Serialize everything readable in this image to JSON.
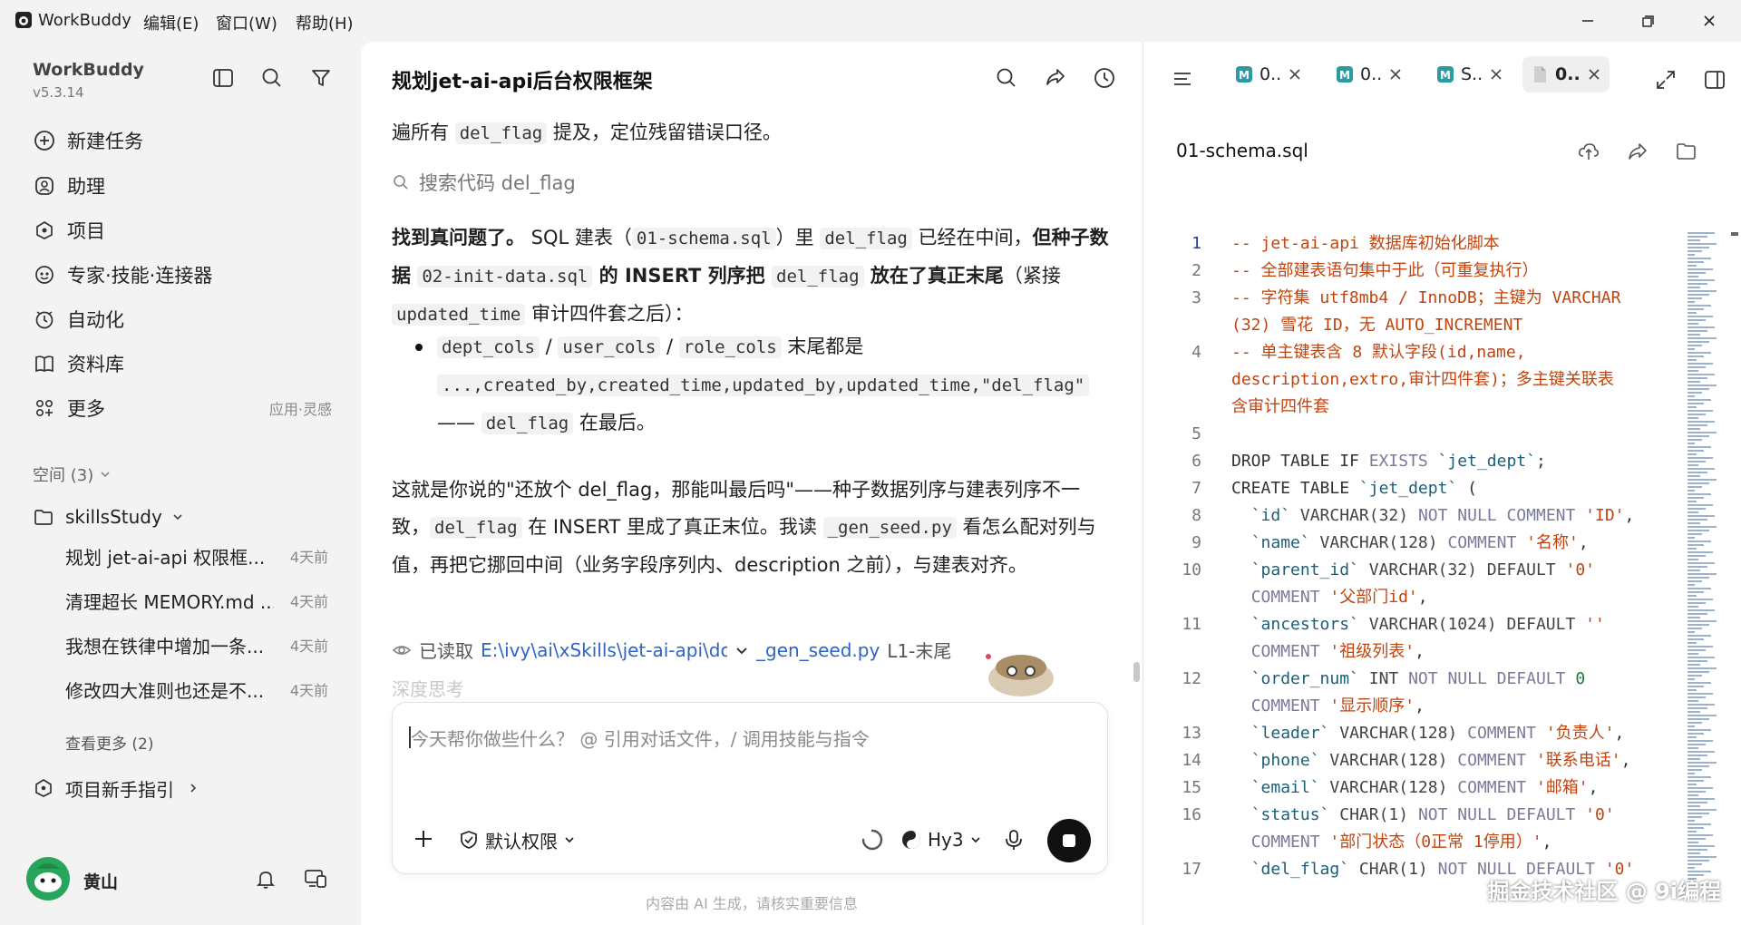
{
  "app": {
    "name": "WorkBuddy",
    "version": "v5.3.14"
  },
  "menu": {
    "edit": "编辑(E)",
    "window": "窗口(W)",
    "help": "帮助(H)"
  },
  "nav": [
    {
      "label": "新建任务",
      "icon": "new-task-icon"
    },
    {
      "label": "助理",
      "icon": "assistant-icon"
    },
    {
      "label": "项目",
      "icon": "project-icon"
    },
    {
      "label": "专家·技能·连接器",
      "icon": "expert-icon"
    },
    {
      "label": "自动化",
      "icon": "automation-icon"
    },
    {
      "label": "资料库",
      "icon": "library-icon"
    },
    {
      "label": "更多",
      "icon": "more-icon",
      "sub": "应用·灵感"
    }
  ],
  "spaces": {
    "label": "空间 (3)"
  },
  "project": {
    "name": "skillsStudy"
  },
  "tasks": [
    {
      "name": "规划 jet-ai-api 权限框...",
      "time": "4天前"
    },
    {
      "name": "清理超长 MEMORY.md ...",
      "time": "4天前"
    },
    {
      "name": "我想在铁律中增加一条...",
      "time": "4天前"
    },
    {
      "name": "修改四大准则也还是不...",
      "time": "4天前"
    }
  ],
  "view_more": "查看更多 (2)",
  "guide": "项目新手指引",
  "user": {
    "name": "黄山"
  },
  "chat": {
    "title": "规划jet-ai-api后台权限框架",
    "p0_a": "遍所有 ",
    "p0_code": "del_flag",
    "p0_b": " 提及，定位残留错误口径。",
    "search": "搜索代码 del_flag",
    "p1_bold1": "找到真问题了。",
    "p1_a": " SQL 建表（",
    "p1_code1": "01-schema.sql",
    "p1_b": "）里 ",
    "p1_code2": "del_flag",
    "p1_c": " 已经在中间，",
    "p1_bold2": "但种子数据 ",
    "p1_code3": "02-init-data.sql",
    "p1_bold3": " 的 INSERT 列序把 ",
    "p1_code4": "del_flag",
    "p1_bold4": " 放在了真正末尾",
    "p1_d": "（紧接 ",
    "p1_code5": "updated_time",
    "p1_e": " 审计四件套之后）：",
    "b_code1": "dept_cols",
    "b_sep": " / ",
    "b_code2": "user_cols",
    "b_code3": "role_cols",
    "b_a": " 末尾都是",
    "b_code4": "...,created_by,created_time,updated_by,updated_time,\"del_flag\"",
    "b_dash": "—— ",
    "b_code5": "del_flag",
    "b_b": " 在最后。",
    "p2_a": "这就是你说的\"还放个 del_flag，那能叫最后吗\"——种子数据列序与建表列序不一致，",
    "p2_code1": "del_flag",
    "p2_b": " 在 INSERT 里成了真正末位。我读 ",
    "p2_code2": "_gen_seed.py",
    "p2_c": " 看怎么配对列与值，再把它挪回中间（业务字段序列内、description 之前），与建表对齐。",
    "read_label": "已读取",
    "read_path": "E:\\ivy\\ai\\xSkills\\jet-ai-api\\doc",
    "read_file": "_gen_seed.py",
    "read_range": "L1-末尾",
    "faded": "深度思考",
    "input_placeholder": "今天帮你做些什么？ @ 引用对话文件，/ 调用技能与指令",
    "permission": "默认权限",
    "model": "Hy3",
    "disclaimer": "内容由 AI 生成，请核实重要信息"
  },
  "editor": {
    "tabs": [
      "0..",
      "0..",
      "S..",
      "0.."
    ],
    "file_title": "01-schema.sql"
  },
  "code": [
    {
      "n": "1",
      "segs": [
        [
          "cm",
          "-- jet-ai-api 数据库初始化脚本"
        ]
      ]
    },
    {
      "n": "2",
      "segs": [
        [
          "cm",
          "-- 全部建表语句集中于此（可重复执行）"
        ]
      ]
    },
    {
      "n": "3",
      "segs": [
        [
          "cm",
          "-- 字符集 utf8mb4 / InnoDB；主键为 VARCHAR"
        ]
      ]
    },
    {
      "n": "",
      "segs": [
        [
          "cm",
          "(32) 雪花 ID，无 AUTO_INCREMENT"
        ]
      ]
    },
    {
      "n": "4",
      "segs": [
        [
          "cm",
          "-- 单主键表含 8 默认字段(id,name,"
        ]
      ]
    },
    {
      "n": "",
      "segs": [
        [
          "cm",
          "description,extro,审计四件套)；多主键关联表"
        ]
      ]
    },
    {
      "n": "",
      "segs": [
        [
          "cm",
          "含审计四件套"
        ]
      ]
    },
    {
      "n": "5",
      "segs": []
    },
    {
      "n": "6",
      "segs": [
        [
          "kk",
          "DROP TABLE IF "
        ],
        [
          "kw",
          "EXISTS"
        ],
        [
          "kk",
          " "
        ],
        [
          "id",
          "`jet_dept`"
        ],
        [
          "kk",
          ";"
        ]
      ]
    },
    {
      "n": "7",
      "segs": [
        [
          "kk",
          "CREATE TABLE "
        ],
        [
          "id",
          "`jet_dept`"
        ],
        [
          "kk",
          " ("
        ]
      ]
    },
    {
      "n": "8",
      "segs": [
        [
          "kk",
          "  "
        ],
        [
          "id",
          "`id`"
        ],
        [
          "ty",
          " VARCHAR(32) "
        ],
        [
          "kw",
          "NOT NULL COMMENT"
        ],
        [
          "kk",
          " "
        ],
        [
          "st",
          "'ID'"
        ],
        [
          "kk",
          ","
        ]
      ]
    },
    {
      "n": "9",
      "segs": [
        [
          "kk",
          "  "
        ],
        [
          "id",
          "`name`"
        ],
        [
          "ty",
          " VARCHAR(128) "
        ],
        [
          "kw",
          "COMMENT"
        ],
        [
          "kk",
          " "
        ],
        [
          "st",
          "'名称'"
        ],
        [
          "kk",
          ","
        ]
      ]
    },
    {
      "n": "10",
      "segs": [
        [
          "kk",
          "  "
        ],
        [
          "id",
          "`parent_id`"
        ],
        [
          "ty",
          " VARCHAR(32) DEFAULT "
        ],
        [
          "st",
          "'0'"
        ]
      ]
    },
    {
      "n": "",
      "segs": [
        [
          "kk",
          "  "
        ],
        [
          "kw",
          "COMMENT"
        ],
        [
          "kk",
          " "
        ],
        [
          "st",
          "'父部门id'"
        ],
        [
          "kk",
          ","
        ]
      ]
    },
    {
      "n": "11",
      "segs": [
        [
          "kk",
          "  "
        ],
        [
          "id",
          "`ancestors`"
        ],
        [
          "ty",
          " VARCHAR(1024) DEFAULT "
        ],
        [
          "st",
          "''"
        ]
      ]
    },
    {
      "n": "",
      "segs": [
        [
          "kk",
          "  "
        ],
        [
          "kw",
          "COMMENT"
        ],
        [
          "kk",
          " "
        ],
        [
          "st",
          "'祖级列表'"
        ],
        [
          "kk",
          ","
        ]
      ]
    },
    {
      "n": "12",
      "segs": [
        [
          "kk",
          "  "
        ],
        [
          "id",
          "`order_num`"
        ],
        [
          "ty",
          " INT "
        ],
        [
          "kw",
          "NOT NULL DEFAULT"
        ],
        [
          "kk",
          " "
        ],
        [
          "nm",
          "0"
        ]
      ]
    },
    {
      "n": "",
      "segs": [
        [
          "kk",
          "  "
        ],
        [
          "kw",
          "COMMENT"
        ],
        [
          "kk",
          " "
        ],
        [
          "st",
          "'显示顺序'"
        ],
        [
          "kk",
          ","
        ]
      ]
    },
    {
      "n": "13",
      "segs": [
        [
          "kk",
          "  "
        ],
        [
          "id",
          "`leader`"
        ],
        [
          "ty",
          " VARCHAR(128) "
        ],
        [
          "kw",
          "COMMENT"
        ],
        [
          "kk",
          " "
        ],
        [
          "st",
          "'负责人'"
        ],
        [
          "kk",
          ","
        ]
      ]
    },
    {
      "n": "14",
      "segs": [
        [
          "kk",
          "  "
        ],
        [
          "id",
          "`phone`"
        ],
        [
          "ty",
          " VARCHAR(128) "
        ],
        [
          "kw",
          "COMMENT"
        ],
        [
          "kk",
          " "
        ],
        [
          "st",
          "'联系电话'"
        ],
        [
          "kk",
          ","
        ]
      ]
    },
    {
      "n": "15",
      "segs": [
        [
          "kk",
          "  "
        ],
        [
          "id",
          "`email`"
        ],
        [
          "ty",
          " VARCHAR(128) "
        ],
        [
          "kw",
          "COMMENT"
        ],
        [
          "kk",
          " "
        ],
        [
          "st",
          "'邮箱'"
        ],
        [
          "kk",
          ","
        ]
      ]
    },
    {
      "n": "16",
      "segs": [
        [
          "kk",
          "  "
        ],
        [
          "id",
          "`status`"
        ],
        [
          "ty",
          " CHAR(1) "
        ],
        [
          "kw",
          "NOT NULL DEFAULT"
        ],
        [
          "kk",
          " "
        ],
        [
          "st",
          "'0'"
        ]
      ]
    },
    {
      "n": "",
      "segs": [
        [
          "kk",
          "  "
        ],
        [
          "kw",
          "COMMENT"
        ],
        [
          "kk",
          " "
        ],
        [
          "st",
          "'部门状态（0正常 1停用）'"
        ],
        [
          "kk",
          ","
        ]
      ]
    },
    {
      "n": "17",
      "segs": [
        [
          "kk",
          "  "
        ],
        [
          "id",
          "`del_flag`"
        ],
        [
          "ty",
          " CHAR(1) "
        ],
        [
          "kw",
          "NOT NULL DEFAULT"
        ],
        [
          "kk",
          " "
        ],
        [
          "st",
          "'0'"
        ]
      ]
    }
  ],
  "watermark": "掘金技术社区 @ 9i编程"
}
